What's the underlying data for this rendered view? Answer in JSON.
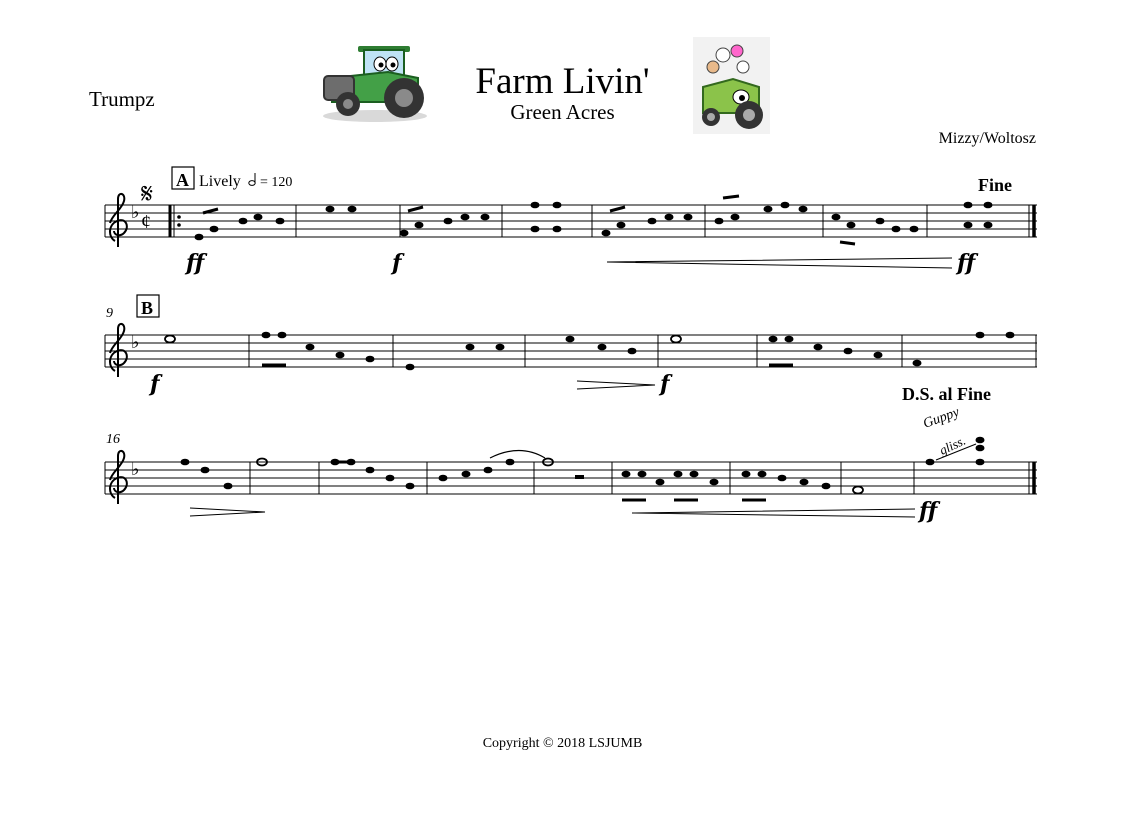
{
  "header": {
    "part_name": "Trumpz",
    "title": "Farm Livin'",
    "subtitle": "Green Acres",
    "composer": "Mizzy/Woltosz",
    "images": [
      "tractor-cartoon",
      "tractor-with-animals-cartoon"
    ]
  },
  "score": {
    "tempo_text": "Lively",
    "tempo_value": "= 120",
    "segno": "𝄋",
    "systems": [
      {
        "measure_number": "",
        "rehearsal_mark": "A",
        "dynamics": [
          "ff",
          "f",
          "ff"
        ],
        "markings": [
          "Fine"
        ]
      },
      {
        "measure_number": "9",
        "rehearsal_mark": "B",
        "dynamics": [
          "f",
          "f"
        ],
        "markings": [
          "D.S. al Fine"
        ]
      },
      {
        "measure_number": "16",
        "rehearsal_mark": "",
        "dynamics": [
          "ff"
        ],
        "markings": [
          "Guppy",
          "gliss."
        ]
      }
    ]
  },
  "footer": {
    "copyright": "Copyright © 2018 LSJUMB"
  }
}
